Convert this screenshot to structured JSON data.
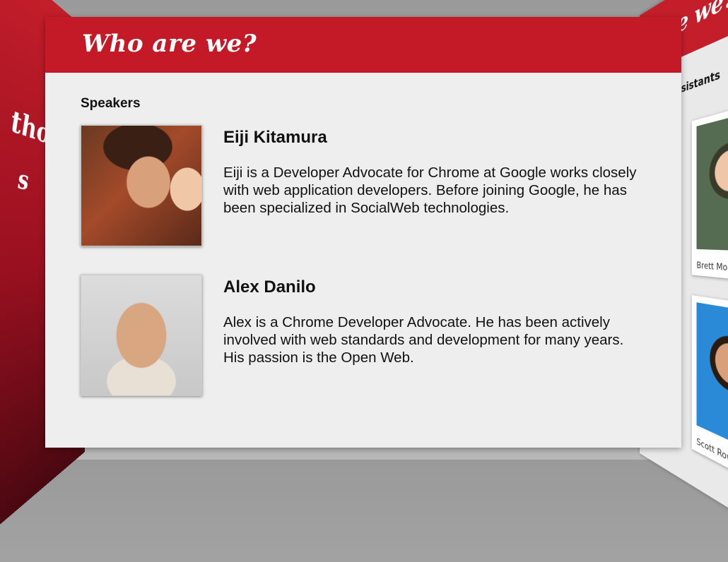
{
  "slide": {
    "title": "Who are we?",
    "section_label": "Speakers",
    "people": [
      {
        "name": "Eiji Kitamura",
        "bio": "Eiji is a Developer Advocate for Chrome at Google works closely with web application developers. Before joining Google, he has been specialized in SocialWeb technologies."
      },
      {
        "name": "Alex Danilo",
        "bio": "Alex is a Chrome Developer Advocate. He has been actively involved with web standards and development for many years. His passion is the Open Web."
      }
    ]
  },
  "left_slide": {
    "text_line1": "thoring",
    "text_line2": "s"
  },
  "right_slide": {
    "title": "are we?",
    "section_label": "ng Assistants",
    "cards": [
      {
        "name": "Brett Morgan"
      },
      {
        "name": "Scott Rowe"
      }
    ]
  },
  "colors": {
    "brand_red": "#c41a27",
    "slide_background": "#eeeeee"
  }
}
